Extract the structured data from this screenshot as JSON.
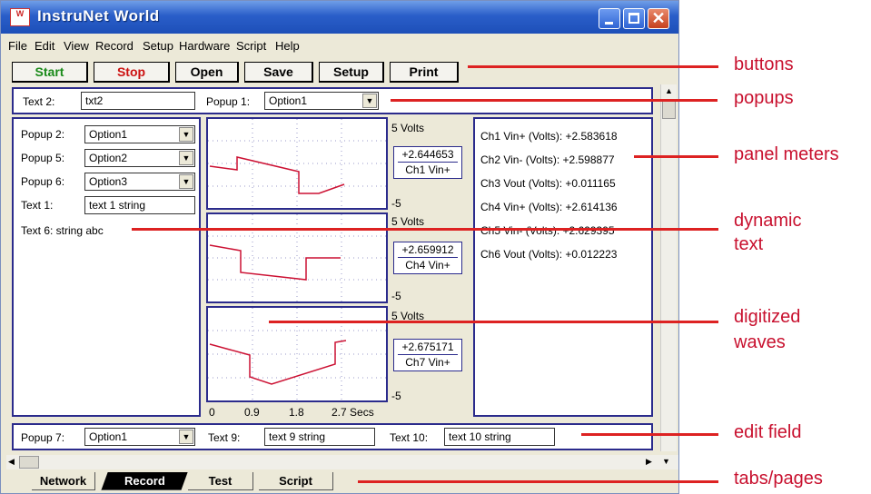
{
  "window": {
    "title": "InstruNet World",
    "menu": [
      "File",
      "Edit",
      "View",
      "Record",
      "Setup",
      "Hardware",
      "Script",
      "Help"
    ]
  },
  "buttons": [
    {
      "label": "Start",
      "color": "#1a8a1a"
    },
    {
      "label": "Stop",
      "color": "#cc1111"
    },
    {
      "label": "Open",
      "color": "#000000"
    },
    {
      "label": "Save",
      "color": "#000000"
    },
    {
      "label": "Setup",
      "color": "#000000"
    },
    {
      "label": "Print",
      "color": "#000000"
    }
  ],
  "top_row": {
    "text2_label": "Text 2:",
    "text2_value": "txt2",
    "popup1_label": "Popup 1:",
    "popup1_value": "Option1"
  },
  "left_panel": {
    "popup2_label": "Popup 2:",
    "popup2_value": "Option1",
    "popup5_label": "Popup 5:",
    "popup5_value": "Option2",
    "popup6_label": "Popup 6:",
    "popup6_value": "Option3",
    "text1_label": "Text 1:",
    "text1_value": "text 1 string",
    "text6": "Text 6: string abc"
  },
  "graphs": [
    {
      "top_label": "5 Volts",
      "bottom_label": "-5",
      "meter_value": "+2.644653",
      "meter_channel": "Ch1 Vin+"
    },
    {
      "top_label": "5 Volts",
      "bottom_label": "-5",
      "meter_value": "+2.659912",
      "meter_channel": "Ch4 Vin+"
    },
    {
      "top_label": "5 Volts",
      "bottom_label": "-5",
      "meter_value": "+2.675171",
      "meter_channel": "Ch7 Vin+"
    }
  ],
  "x_axis": [
    "0",
    "0.9",
    "1.8",
    "2.7 Secs"
  ],
  "meters": [
    "Ch1 Vin+ (Volts): +2.583618",
    "Ch2 Vin- (Volts): +2.598877",
    "Ch3 Vout (Volts): +0.011165",
    "Ch4 Vin+ (Volts): +2.614136",
    "Ch5 Vin- (Volts): +2.629395",
    "Ch6 Vout (Volts): +0.012223"
  ],
  "bottom_row": {
    "popup7_label": "Popup 7:",
    "popup7_value": "Option1",
    "text9_label": "Text 9:",
    "text9_value": "text 9 string",
    "text10_label": "Text 10:",
    "text10_value": "text 10 string"
  },
  "tabs": [
    "Network",
    "Record",
    "Test",
    "Script"
  ],
  "active_tab": "Record",
  "callouts": [
    "buttons",
    "popups",
    "panel meters",
    "dynamic",
    "text",
    "digitized",
    "waves",
    "edit field",
    "tabs/pages"
  ],
  "colors": {
    "callout": "#c8102e",
    "panel_border": "#2b2b8c",
    "wave": "#cc1133"
  }
}
